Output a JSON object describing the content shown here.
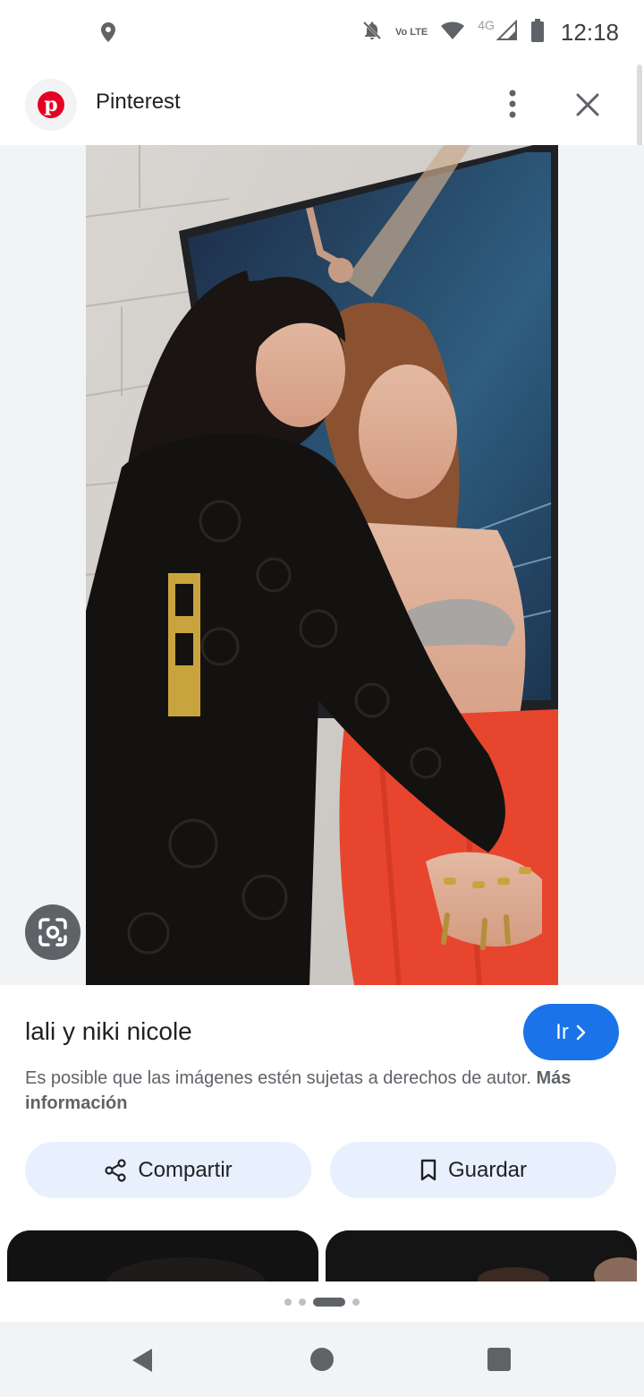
{
  "status_bar": {
    "time": "12:18",
    "lte_label": "Vo LTE",
    "network_label": "4G",
    "icons": [
      "location-icon",
      "notifications-off-icon",
      "wifi-icon",
      "signal-icon",
      "battery-icon"
    ]
  },
  "header": {
    "site_name": "Pinterest",
    "site_icon": "pinterest-logo",
    "more_icon": "more-vertical-icon",
    "close_icon": "close-icon"
  },
  "image": {
    "lens_icon": "google-lens-icon"
  },
  "result": {
    "title": "lali y niki nicole",
    "go_label": "Ir",
    "copyright_text": "Es posible que las imágenes estén sujetas a derechos de autor.",
    "more_info_label": "Más información"
  },
  "actions": {
    "share_label": "Compartir",
    "save_label": "Guardar"
  },
  "pager": {
    "page_count": 4,
    "active_index": 2
  },
  "colors": {
    "accent": "#1a73e8",
    "pinterest_red": "#e60023",
    "chip_bg": "#e8f0fe"
  }
}
